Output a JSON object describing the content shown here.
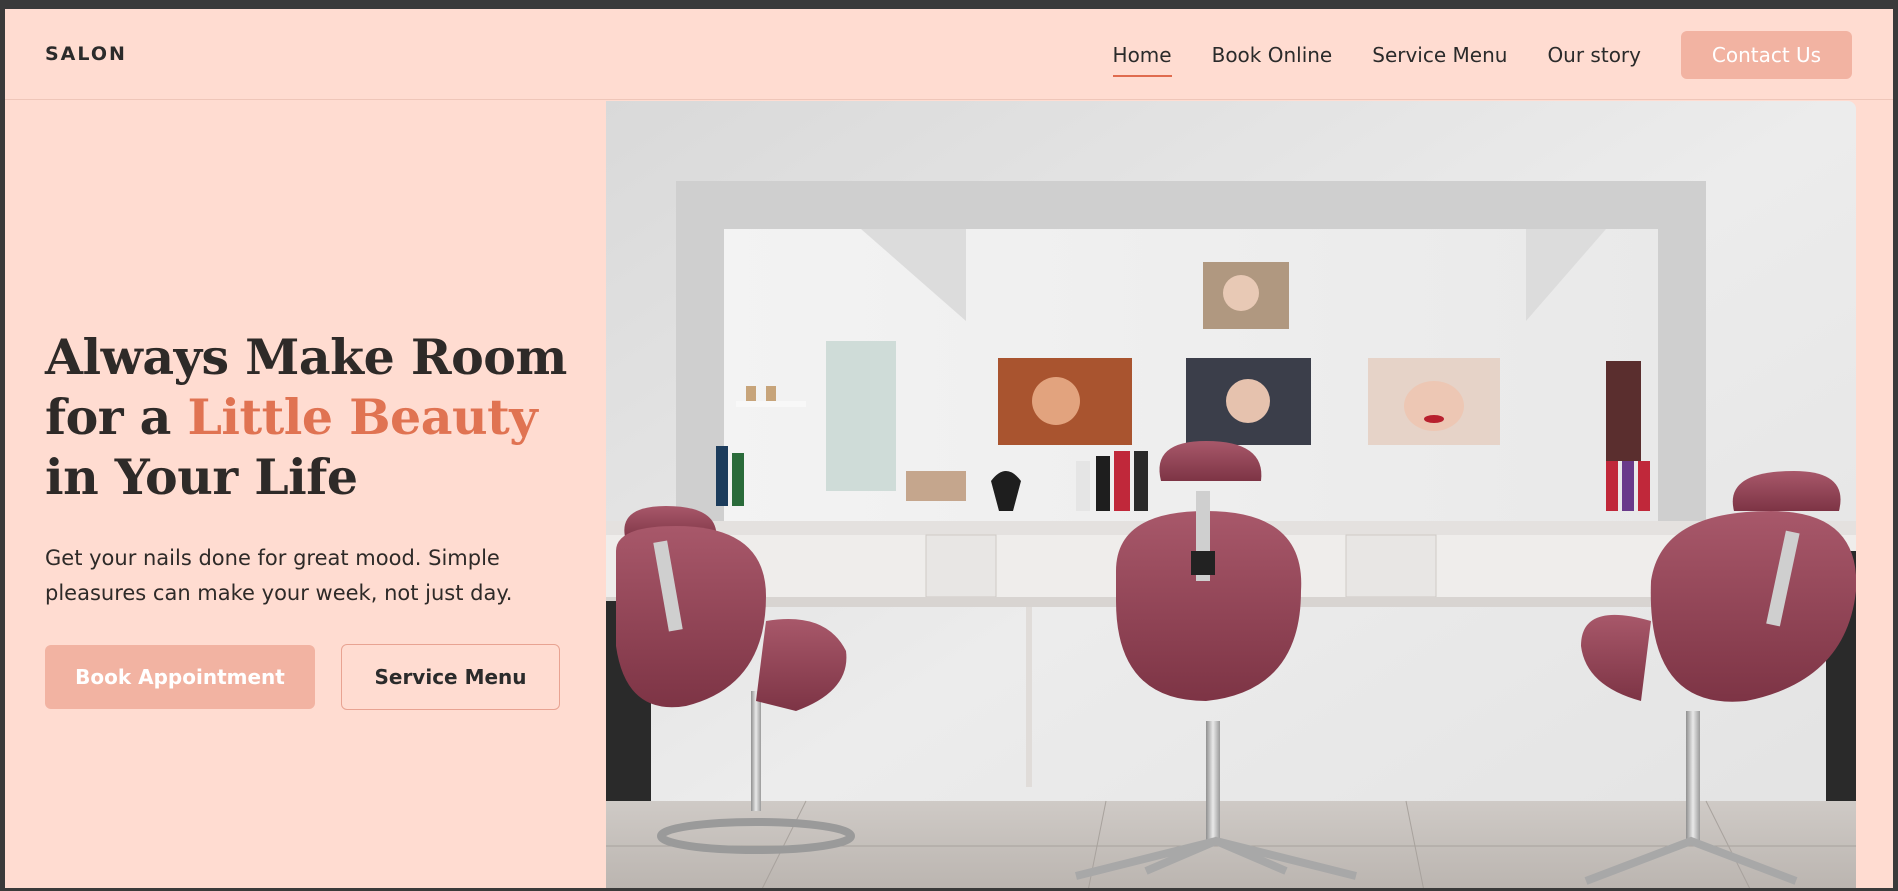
{
  "brand": {
    "logo": "SALON"
  },
  "nav": {
    "items": [
      {
        "label": "Home",
        "active": true
      },
      {
        "label": "Book Online"
      },
      {
        "label": "Service Menu"
      },
      {
        "label": "Our story"
      }
    ],
    "cta": "Contact Us"
  },
  "hero": {
    "title_part1": "Always Make Room for a ",
    "title_accent": "Little Beauty",
    "title_part2": " in Your Life",
    "subtitle": "Get your nails done for great mood. Simple pleasures can make your week, not just day.",
    "primary_button": "Book Appointment",
    "secondary_button": "Service Menu"
  },
  "colors": {
    "background": "#ffdcd1",
    "accent": "#e07352",
    "button": "#f2b3a2",
    "text": "#2e2a28"
  }
}
